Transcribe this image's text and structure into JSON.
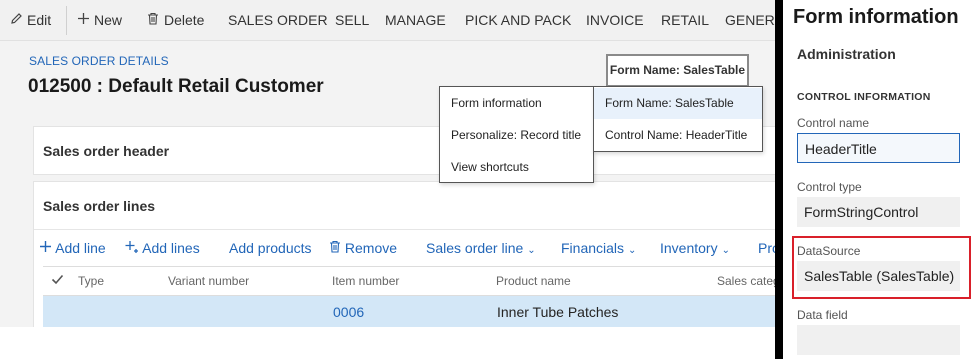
{
  "actionbar": {
    "items": [
      {
        "label": "Edit",
        "icon": "pencil-icon"
      },
      {
        "label": "New",
        "icon": "plus-icon"
      },
      {
        "label": "Delete",
        "icon": "trash-icon"
      },
      {
        "label": "SALES ORDER"
      },
      {
        "label": "SELL"
      },
      {
        "label": "MANAGE"
      },
      {
        "label": "PICK AND PACK"
      },
      {
        "label": "INVOICE"
      },
      {
        "label": "RETAIL"
      },
      {
        "label": "GENERA"
      }
    ]
  },
  "page": {
    "breadcrumb": "SALES ORDER DETAILS",
    "title": "012500 : Default Retail Customer"
  },
  "sections": {
    "header_title": "Sales order header",
    "lines_title": "Sales order lines"
  },
  "lines_toolbar": [
    {
      "label": "Add line",
      "icon": "plus-icon"
    },
    {
      "label": "Add lines",
      "icon": "add-lines-icon"
    },
    {
      "label": "Add products"
    },
    {
      "label": "Remove",
      "icon": "trash-icon"
    },
    {
      "label": "Sales order line",
      "dropdown": true
    },
    {
      "label": "Financials",
      "dropdown": true
    },
    {
      "label": "Inventory",
      "dropdown": true
    },
    {
      "label": "Pro"
    }
  ],
  "grid": {
    "columns": [
      "Type",
      "Variant number",
      "Item number",
      "Product name",
      "Sales categ"
    ],
    "rows": [
      {
        "type": "",
        "variant": "",
        "item": "0006",
        "product": "Inner Tube Patches",
        "category": ""
      }
    ]
  },
  "tooltip": {
    "form_name": "Form Name: SalesTable"
  },
  "context_menu": {
    "items": [
      "Form information",
      "Personalize: Record title",
      "View shortcuts"
    ]
  },
  "sub_menu": {
    "items": [
      "Form Name: SalesTable",
      "Control Name: HeaderTitle"
    ]
  },
  "panel": {
    "title": "Form information",
    "section": "Administration",
    "group": "CONTROL INFORMATION",
    "fields": [
      {
        "label": "Control name",
        "value": "HeaderTitle"
      },
      {
        "label": "Control type",
        "value": "FormStringControl"
      },
      {
        "label": "DataSource",
        "value": "SalesTable (SalesTable)"
      },
      {
        "label": "Data field",
        "value": ""
      }
    ]
  },
  "colors": {
    "accent": "#2266b8",
    "highlight_border": "#d9202a",
    "selected_row": "#d3e7f7"
  }
}
